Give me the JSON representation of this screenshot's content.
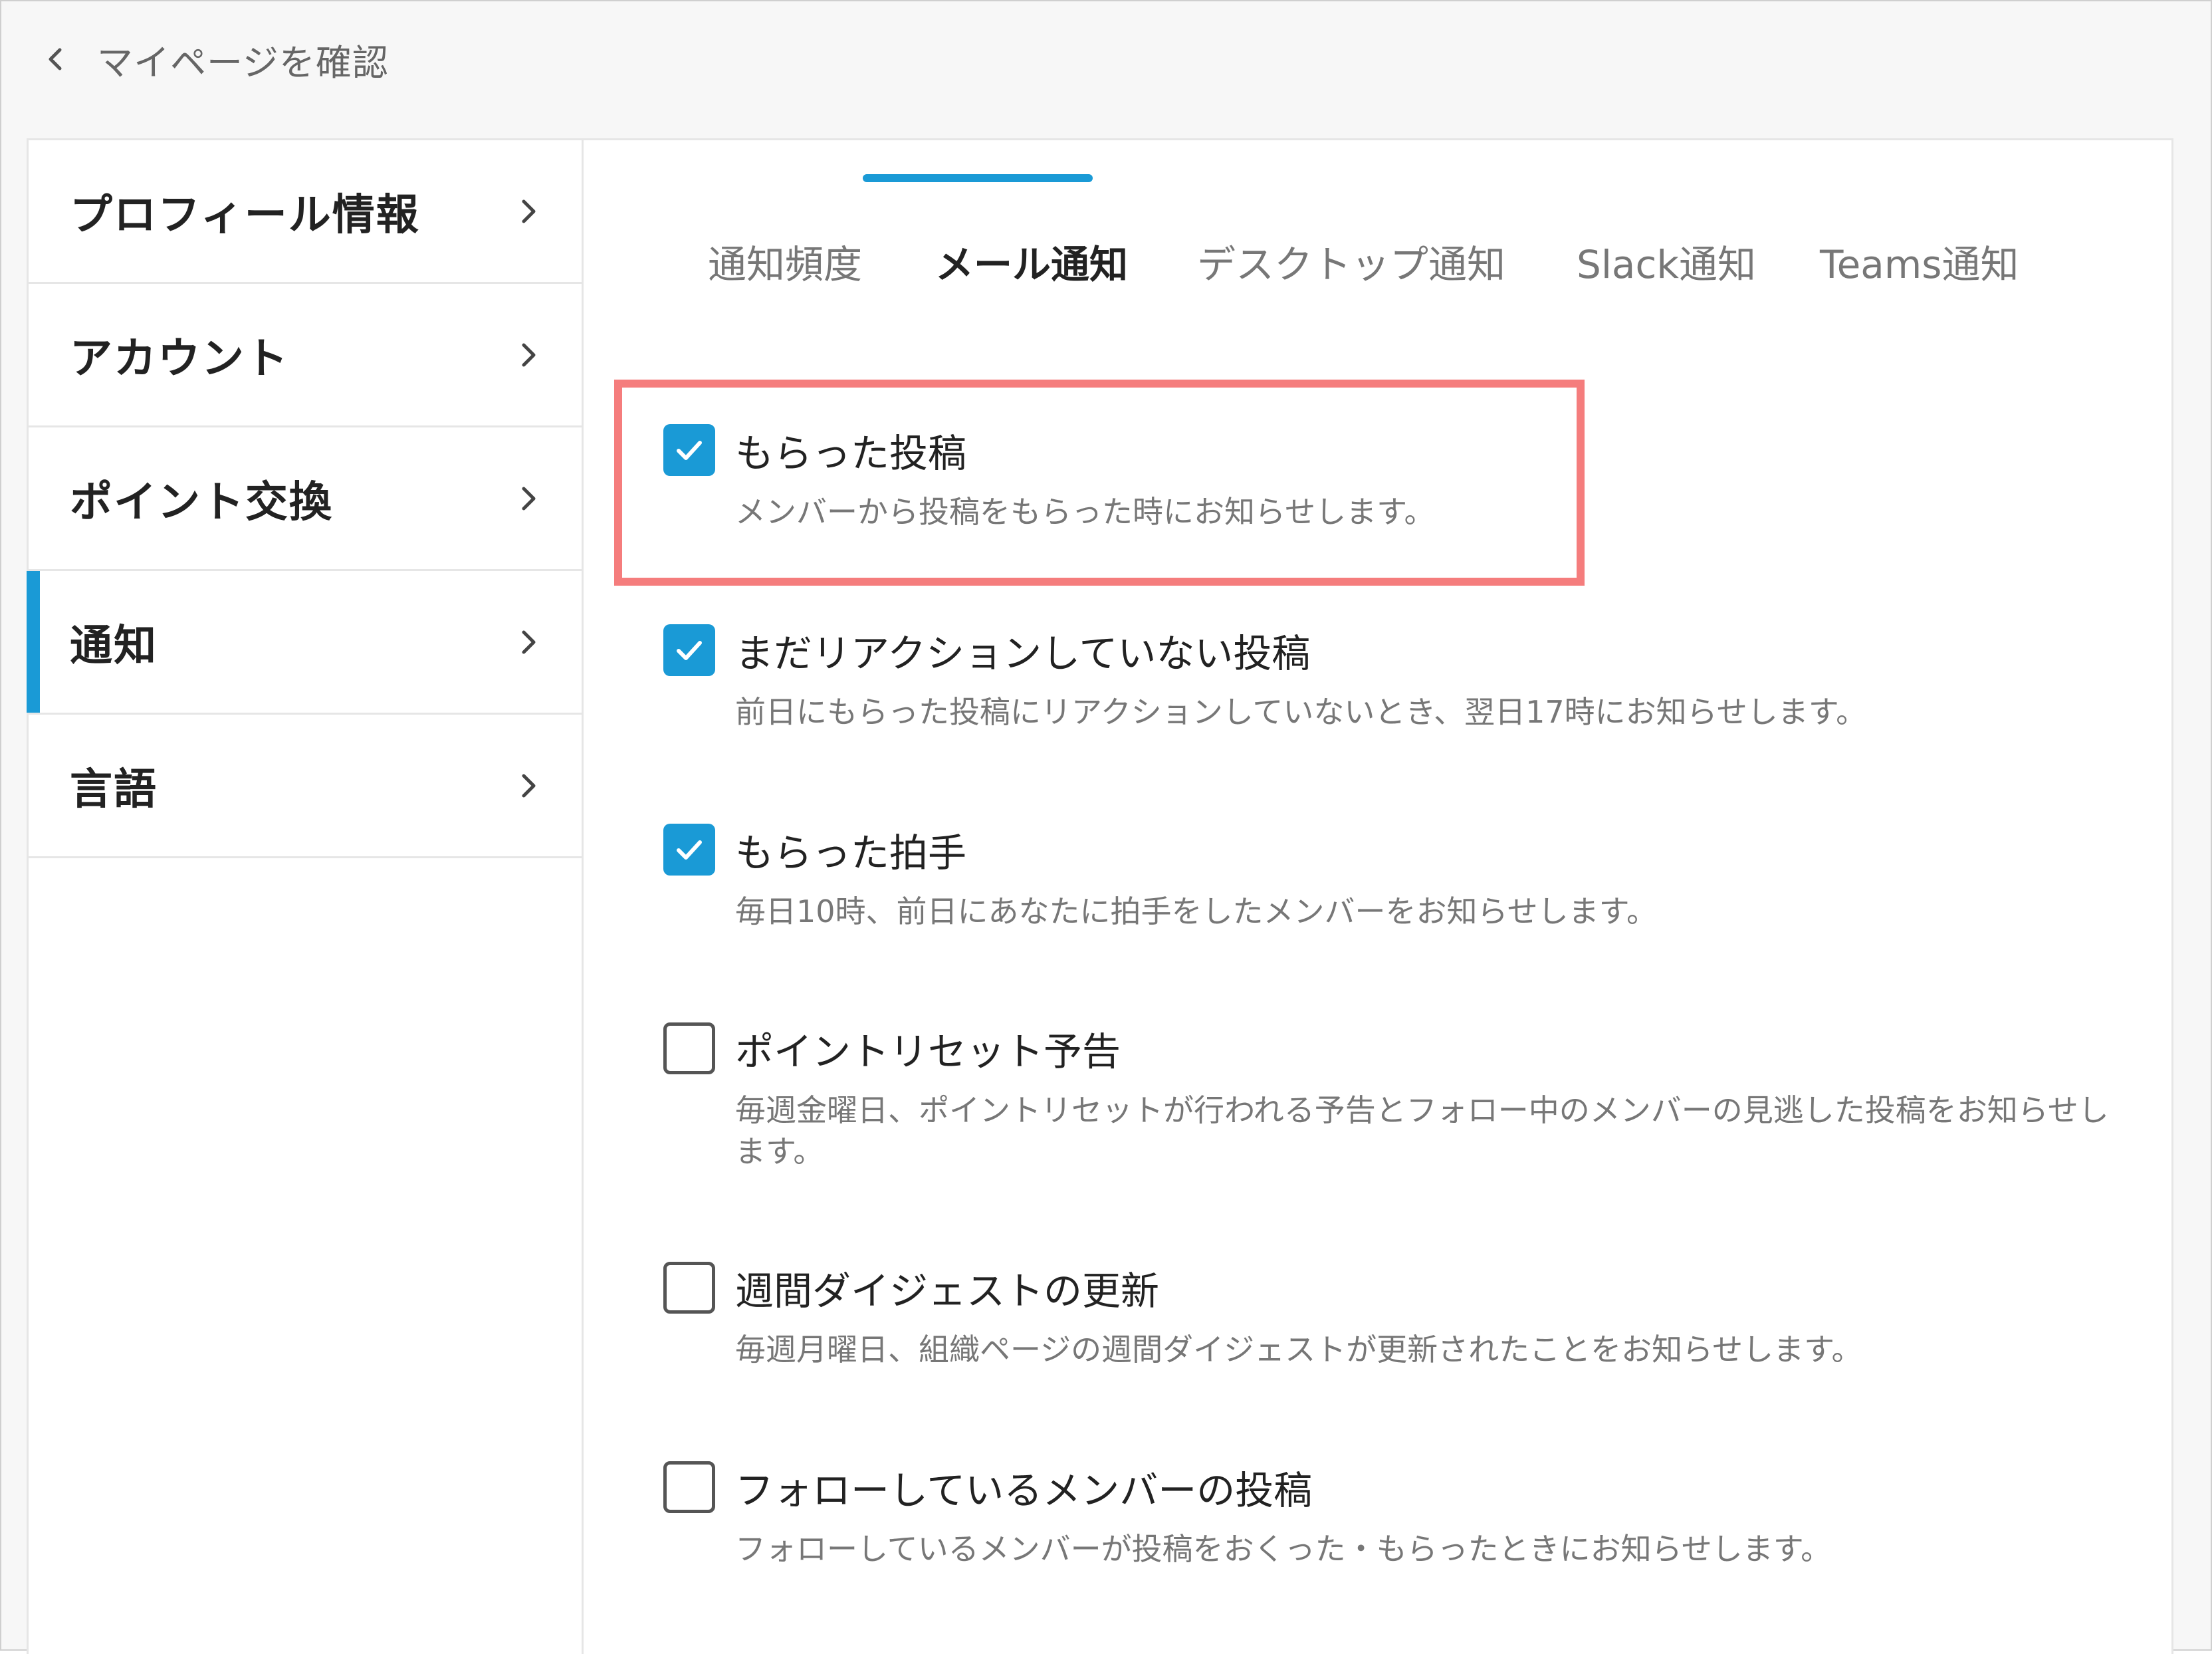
{
  "header": {
    "back_label": "マイページを確認"
  },
  "sidebar": {
    "items": [
      {
        "label": "プロフィール情報",
        "active": false
      },
      {
        "label": "アカウント",
        "active": false
      },
      {
        "label": "ポイント交換",
        "active": false
      },
      {
        "label": "通知",
        "active": true
      },
      {
        "label": "言語",
        "active": false
      }
    ]
  },
  "tabs": {
    "items": [
      {
        "label": "通知頻度",
        "active": false
      },
      {
        "label": "メール通知",
        "active": true
      },
      {
        "label": "デスクトップ通知",
        "active": false
      },
      {
        "label": "Slack通知",
        "active": false
      },
      {
        "label": "Teams通知",
        "active": false
      }
    ]
  },
  "options": [
    {
      "title": "もらった投稿",
      "description": "メンバーから投稿をもらった時にお知らせします。",
      "checked": true,
      "highlighted": true
    },
    {
      "title": "まだリアクションしていない投稿",
      "description": "前日にもらった投稿にリアクションしていないとき、翌日17時にお知らせします。",
      "checked": true
    },
    {
      "title": "もらった拍手",
      "description": "毎日10時、前日にあなたに拍手をしたメンバーをお知らせします。",
      "checked": true
    },
    {
      "title": "ポイントリセット予告",
      "description": "毎週金曜日、ポイントリセットが行われる予告とフォロー中のメンバーの見逃した投稿をお知らせします。",
      "checked": false
    },
    {
      "title": "週間ダイジェストの更新",
      "description": "毎週月曜日、組織ページの週間ダイジェストが更新されたことをお知らせします。",
      "checked": false
    },
    {
      "title": "フォローしているメンバーの投稿",
      "description": "フォローしているメンバーが投稿をおくった・もらったときにお知らせします。",
      "checked": false
    }
  ],
  "colors": {
    "accent": "#1a9ad6",
    "highlight": "#f57d7d"
  },
  "icons": {
    "back": "chevron-left-icon",
    "sidebar_arrow": "chevron-right-icon",
    "checked": "checkmark-icon"
  }
}
